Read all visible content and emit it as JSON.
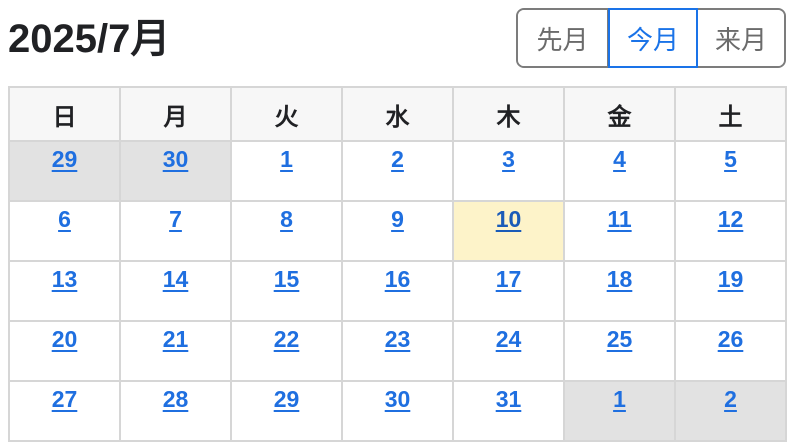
{
  "header": {
    "title": "2025/7月"
  },
  "nav": {
    "prev_label": "先月",
    "current_label": "今月",
    "next_label": "来月"
  },
  "calendar": {
    "weekdays": [
      "日",
      "月",
      "火",
      "水",
      "木",
      "金",
      "土"
    ],
    "weeks": [
      [
        {
          "day": "29",
          "state": "other"
        },
        {
          "day": "30",
          "state": "other"
        },
        {
          "day": "1",
          "state": "normal"
        },
        {
          "day": "2",
          "state": "normal"
        },
        {
          "day": "3",
          "state": "normal"
        },
        {
          "day": "4",
          "state": "normal"
        },
        {
          "day": "5",
          "state": "normal"
        }
      ],
      [
        {
          "day": "6",
          "state": "normal"
        },
        {
          "day": "7",
          "state": "normal"
        },
        {
          "day": "8",
          "state": "normal"
        },
        {
          "day": "9",
          "state": "normal"
        },
        {
          "day": "10",
          "state": "today"
        },
        {
          "day": "11",
          "state": "normal"
        },
        {
          "day": "12",
          "state": "normal"
        }
      ],
      [
        {
          "day": "13",
          "state": "normal"
        },
        {
          "day": "14",
          "state": "normal"
        },
        {
          "day": "15",
          "state": "normal"
        },
        {
          "day": "16",
          "state": "normal"
        },
        {
          "day": "17",
          "state": "normal"
        },
        {
          "day": "18",
          "state": "normal"
        },
        {
          "day": "19",
          "state": "normal"
        }
      ],
      [
        {
          "day": "20",
          "state": "normal"
        },
        {
          "day": "21",
          "state": "normal"
        },
        {
          "day": "22",
          "state": "normal"
        },
        {
          "day": "23",
          "state": "normal"
        },
        {
          "day": "24",
          "state": "normal"
        },
        {
          "day": "25",
          "state": "normal"
        },
        {
          "day": "26",
          "state": "normal"
        }
      ],
      [
        {
          "day": "27",
          "state": "normal"
        },
        {
          "day": "28",
          "state": "normal"
        },
        {
          "day": "29",
          "state": "normal"
        },
        {
          "day": "30",
          "state": "normal"
        },
        {
          "day": "31",
          "state": "normal"
        },
        {
          "day": "1",
          "state": "other"
        },
        {
          "day": "2",
          "state": "other"
        }
      ]
    ]
  },
  "colors": {
    "link": "#1f6fe0",
    "accent": "#1a73e8",
    "other_month_bg": "#e2e2e2",
    "today_bg": "#fdf3c9",
    "header_bg": "#f7f7f7",
    "grid_border": "#d6d6d6"
  }
}
